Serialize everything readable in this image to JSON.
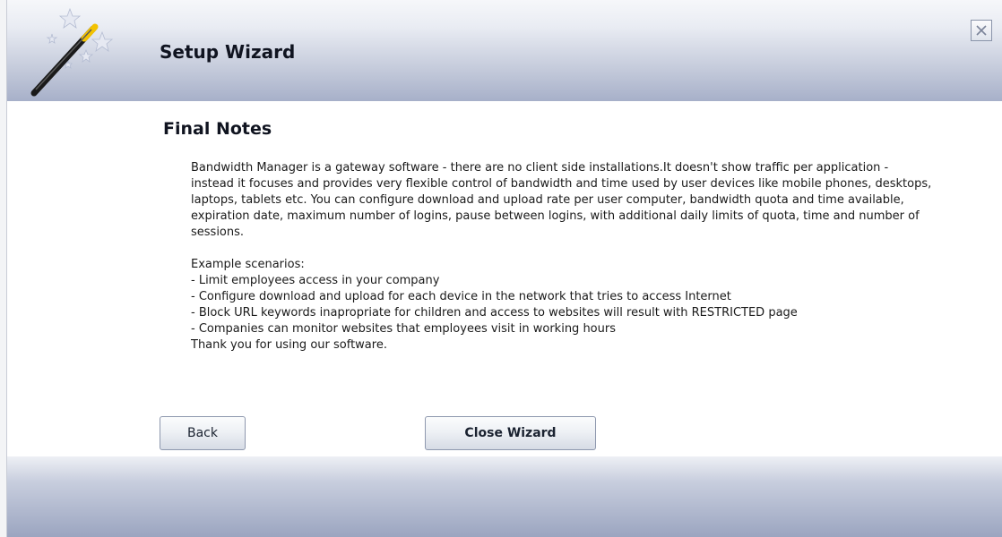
{
  "window": {
    "title": "Setup Wizard",
    "close_icon": "close-x-icon",
    "logo_icon": "magic-wand-icon"
  },
  "page": {
    "title": "Final Notes",
    "paragraph": "Bandwidth Manager is a gateway software - there are no client side installations.It doesn't show traffic per application - instead it focuses and provides very flexible control of bandwidth and time used by user devices like mobile phones, desktops, laptops, tablets etc. You can configure download and upload rate per user computer, bandwidth quota and time available, expiration date, maximum number of logins, pause between logins, with additional daily limits of quota, time and number of sessions.",
    "scenarios_heading": "Example scenarios:",
    "scenarios": [
      "- Limit employees access in your company",
      "- Configure download and upload for each device in the network that tries to access Internet",
      "- Block URL keywords inapropriate for children and access to websites will result with RESTRICTED page",
      "- Companies can monitor websites that employees visit in working hours"
    ],
    "thanks": "Thank you for using our software."
  },
  "buttons": {
    "back": "Back",
    "close_wizard": "Close Wizard"
  },
  "colors": {
    "header_gradient_end": "#a7b0c9",
    "footer_gradient_end": "#9ba5c0",
    "text": "#101420"
  }
}
